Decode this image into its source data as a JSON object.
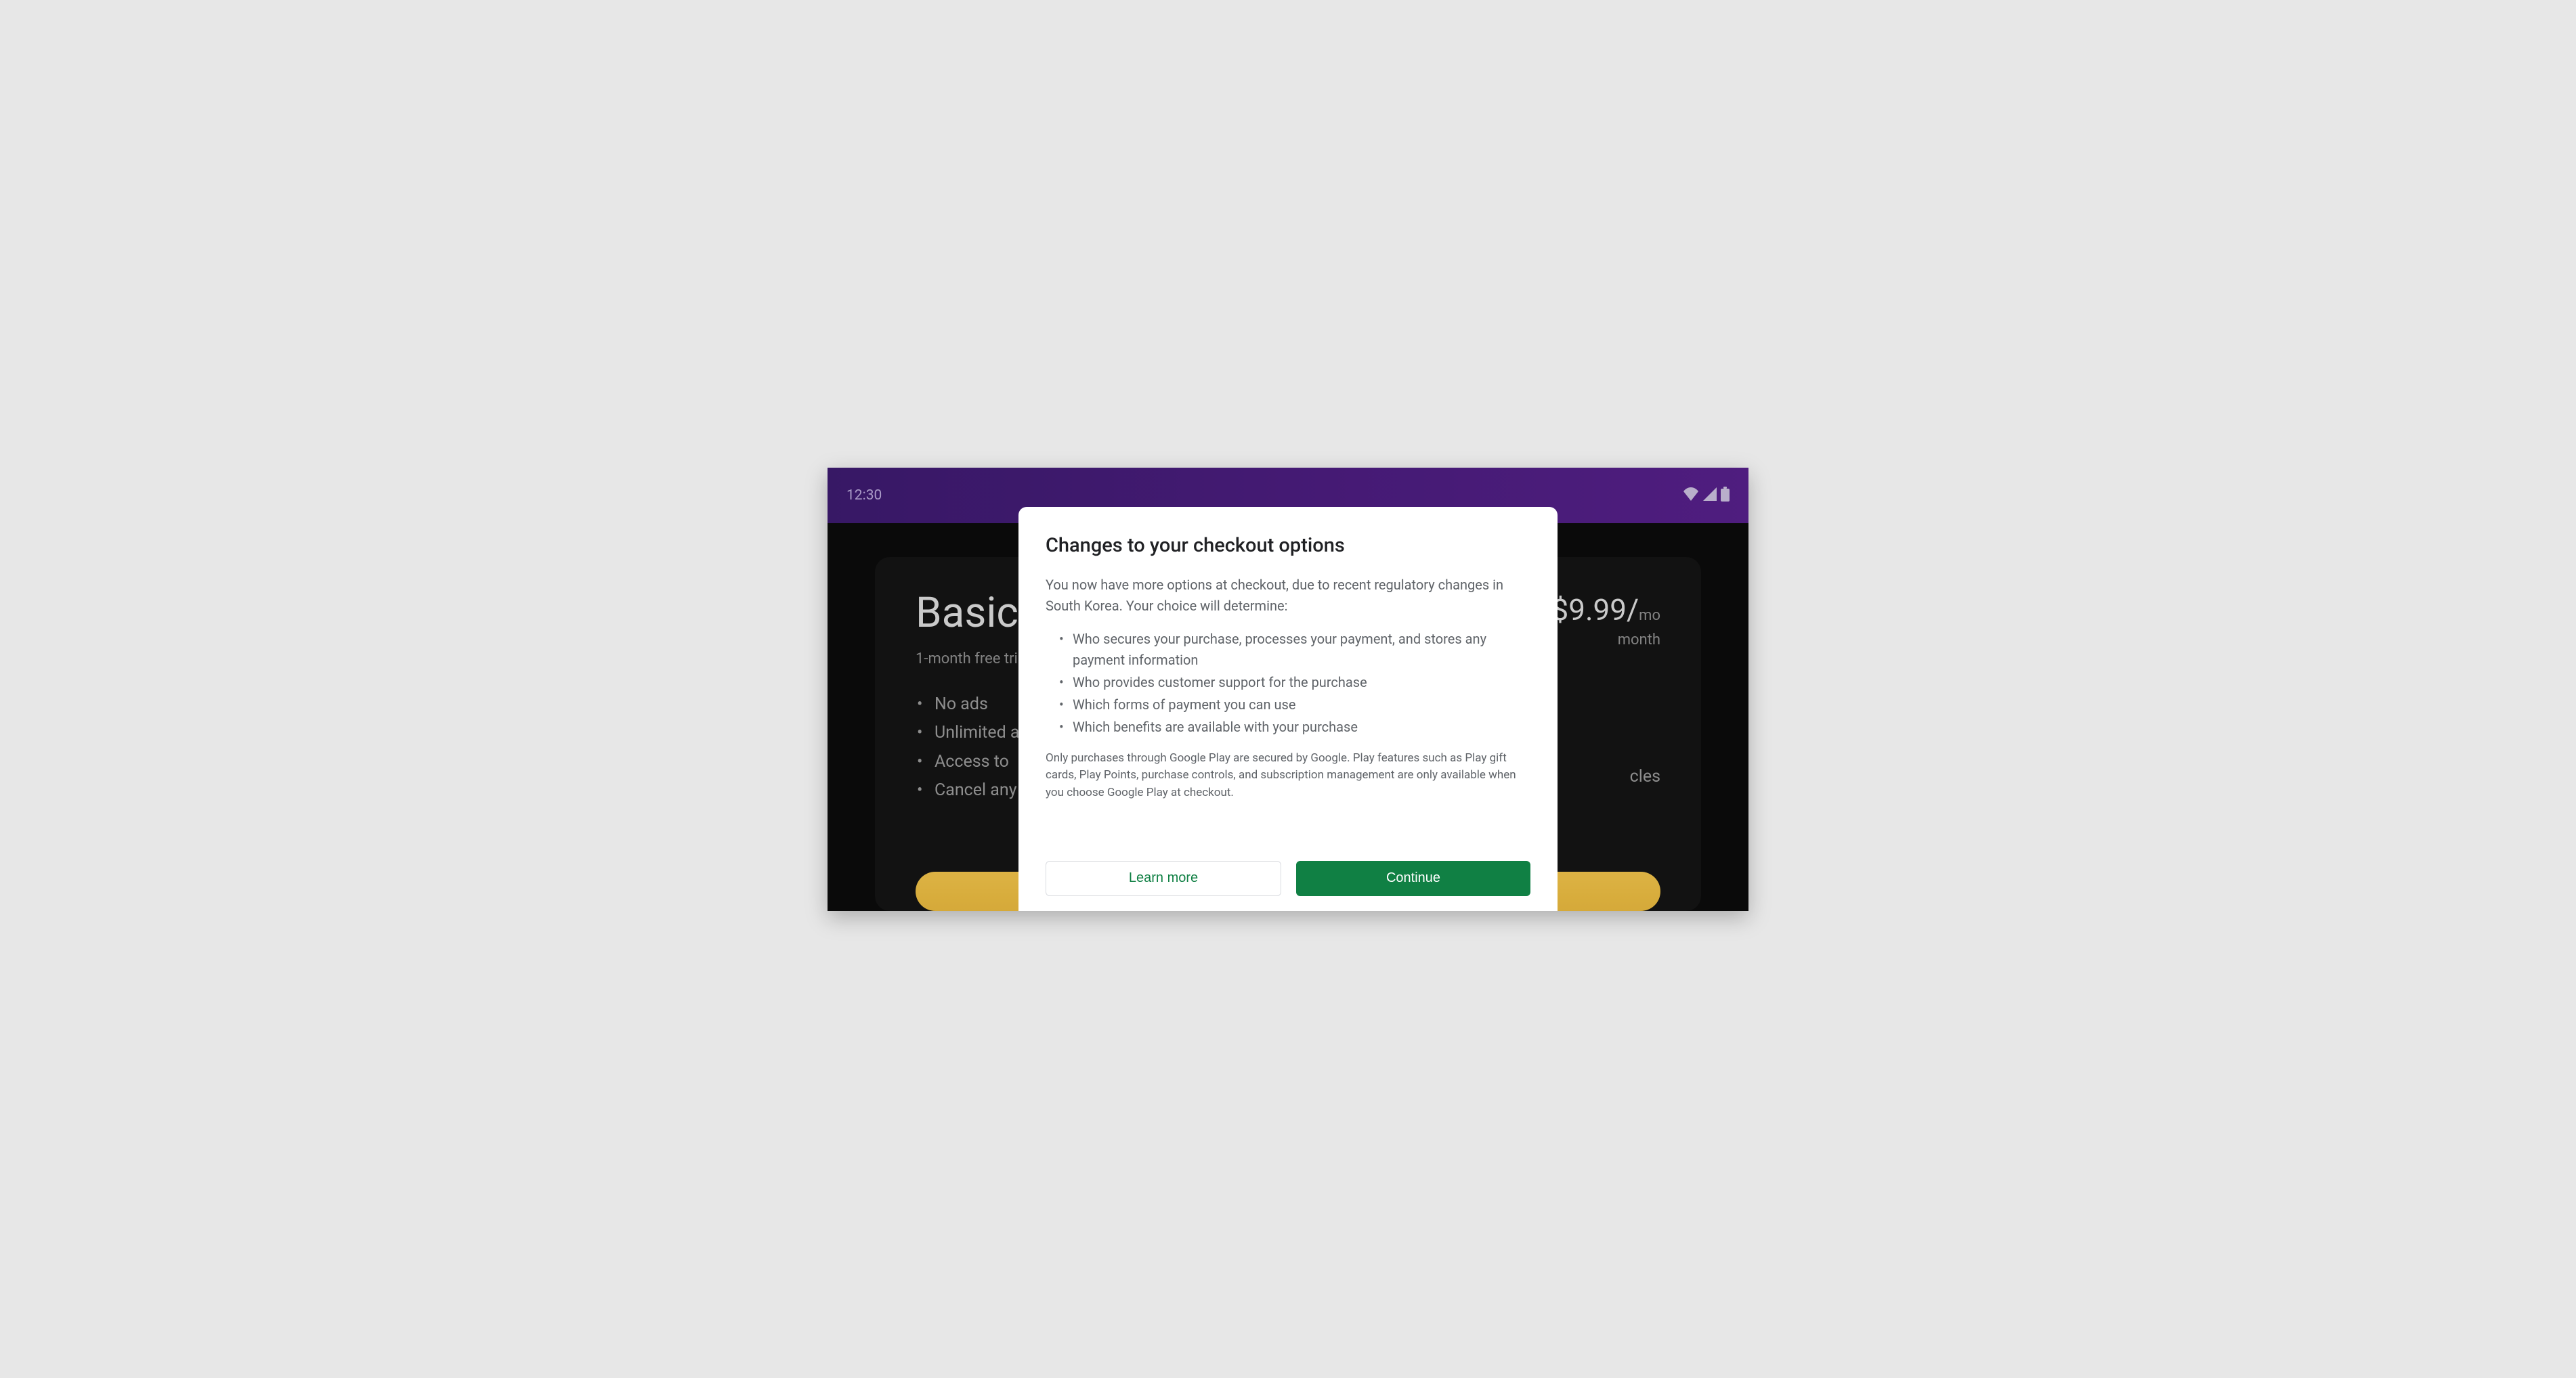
{
  "status": {
    "time": "12:30"
  },
  "plan": {
    "title": "Basic",
    "subtitle": "1-month free trial",
    "price": "$9.99/",
    "price_unit": "mo",
    "price_subtext": "month",
    "features": [
      "No ads",
      "Unlimited a",
      "Access to",
      "Cancel any"
    ],
    "features_right_fragment": "cles"
  },
  "modal": {
    "title": "Changes to your checkout options",
    "intro": "You now have more options at checkout, due to recent regulatory changes in South Korea. Your choice will determine:",
    "bullets": [
      "Who secures your purchase, processes your payment, and stores any payment information",
      "Who provides customer support for the purchase",
      "Which forms of payment you can use",
      "Which benefits are available with your purchase"
    ],
    "footnote": "Only purchases through Google Play are secured by Google. Play features such as Play gift cards, Play Points, purchase controls, and subscription management are only available when you choose Google Play at checkout.",
    "learn_more_label": "Learn more",
    "continue_label": "Continue"
  }
}
